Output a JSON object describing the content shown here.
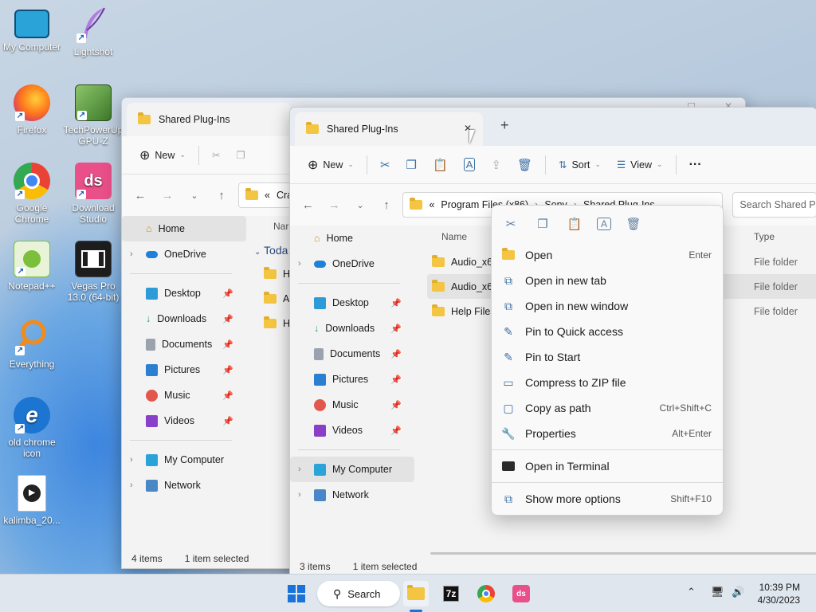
{
  "desktop": {
    "icons": [
      {
        "label": "My Computer",
        "icon": "monitor-icon",
        "color": "#2aa3d9"
      },
      {
        "label": "Lightshot",
        "icon": "feather-icon",
        "color": "#a45fd6"
      },
      {
        "label": "Firefox",
        "icon": "firefox-icon",
        "color": "#ff7a1a"
      },
      {
        "label": "TechPowerUp GPU-Z",
        "icon": "gpuz-icon",
        "color": "#5a9b3a"
      },
      {
        "label": "Google Chrome",
        "icon": "chrome-icon",
        "color": "#4285f4"
      },
      {
        "label": "Download Studio",
        "icon": "download-studio-icon",
        "color": "#e94f89"
      },
      {
        "label": "Notepad++",
        "icon": "notepad-plus-icon",
        "color": "#7bbf3c"
      },
      {
        "label": "Vegas Pro 13.0 (64-bit)",
        "icon": "film-icon",
        "color": "#1d1d1d"
      },
      {
        "label": "Everything",
        "icon": "magnifier-icon",
        "color": "#f28a1c"
      },
      {
        "label": "old chrome icon",
        "icon": "ie-icon",
        "color": "#1c75d1"
      },
      {
        "label": "kalimba_20...",
        "icon": "media-file-icon",
        "color": "#ffffff"
      }
    ]
  },
  "back_window": {
    "tab_title": "Shared Plug-Ins",
    "new_label": "New",
    "address": "Crack",
    "column_name": "Nar",
    "group": "Toda",
    "rows": [
      "He",
      "Au",
      "He"
    ],
    "sidebar": {
      "home": "Home",
      "onedrive": "OneDrive",
      "quick": [
        "Desktop",
        "Downloads",
        "Documents",
        "Pictures",
        "Music",
        "Videos"
      ],
      "my_computer": "My Computer",
      "network": "Network"
    },
    "status_items": "4 items",
    "status_selected": "1 item selected"
  },
  "front_window": {
    "tab_title": "Shared Plug-Ins",
    "close_glyph": "✕",
    "new_tab_glyph": "+",
    "toolbar": {
      "new": "New",
      "sort": "Sort",
      "view": "View",
      "more": "···"
    },
    "breadcrumb": [
      "Program Files (x86)",
      "Sony",
      "Shared Plug-Ins"
    ],
    "breadcrumb_prefix": "«",
    "search_placeholder": "Search Shared P",
    "columns": {
      "name": "Name",
      "type": "Type"
    },
    "files": [
      {
        "name": "Audio_x64",
        "type": "File folder"
      },
      {
        "name": "Audio_x64",
        "type": "File folder"
      },
      {
        "name": "Help Files",
        "type": "File folder"
      }
    ],
    "sidebar": {
      "home": "Home",
      "onedrive": "OneDrive",
      "quick": [
        "Desktop",
        "Downloads",
        "Documents",
        "Pictures",
        "Music",
        "Videos"
      ],
      "my_computer": "My Computer",
      "network": "Network"
    },
    "status_items": "3 items",
    "status_selected": "1 item selected"
  },
  "context_menu": {
    "items": [
      {
        "label": "Open",
        "shortcut": "Enter",
        "icon": "folder-open-icon"
      },
      {
        "label": "Open in new tab",
        "shortcut": "",
        "icon": "new-tab-icon"
      },
      {
        "label": "Open in new window",
        "shortcut": "",
        "icon": "new-window-icon"
      },
      {
        "label": "Pin to Quick access",
        "shortcut": "",
        "icon": "pin-icon"
      },
      {
        "label": "Pin to Start",
        "shortcut": "",
        "icon": "pin-start-icon"
      },
      {
        "label": "Compress to ZIP file",
        "shortcut": "",
        "icon": "zip-icon"
      },
      {
        "label": "Copy as path",
        "shortcut": "Ctrl+Shift+C",
        "icon": "copy-path-icon"
      },
      {
        "label": "Properties",
        "shortcut": "Alt+Enter",
        "icon": "wrench-icon"
      },
      {
        "label": "Open in Terminal",
        "shortcut": "",
        "icon": "terminal-icon"
      },
      {
        "label": "Show more options",
        "shortcut": "Shift+F10",
        "icon": "more-options-icon"
      }
    ]
  },
  "taskbar": {
    "search_label": "Search",
    "time": "10:39 PM",
    "date": "4/30/2023"
  }
}
